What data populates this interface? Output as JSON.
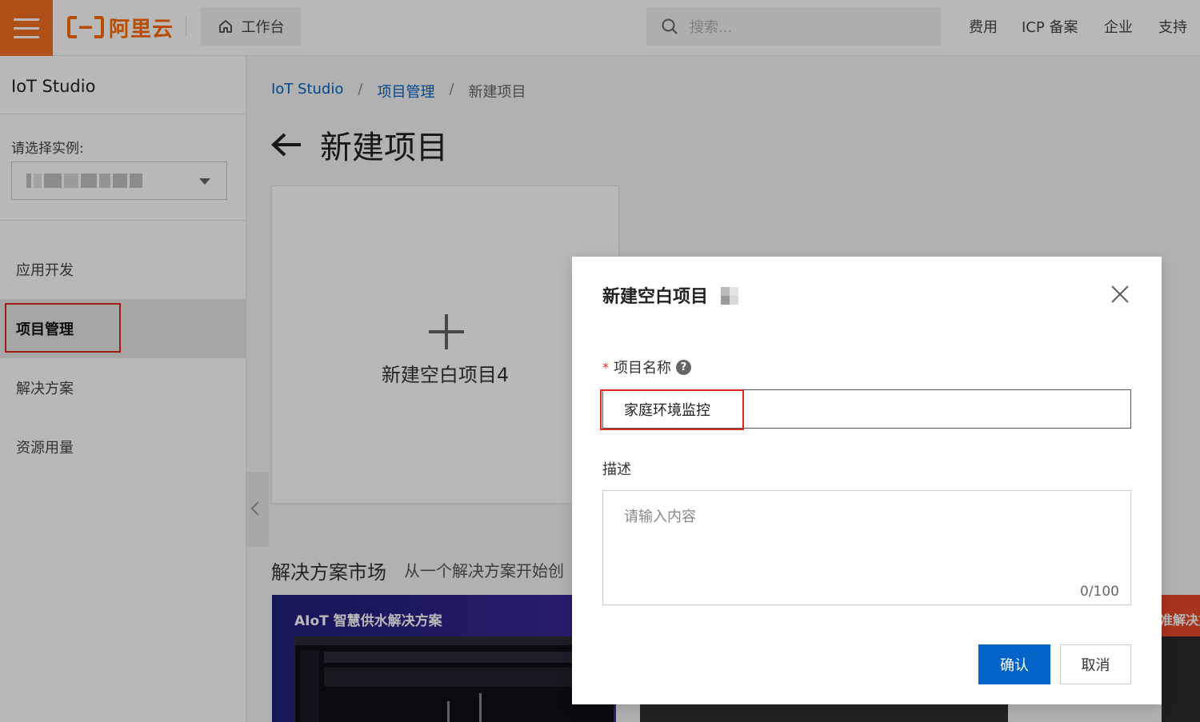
{
  "topbar": {
    "logo_text": "阿里云",
    "workbench_label": "工作台",
    "search_placeholder": "搜索...",
    "nav": [
      "费用",
      "ICP 备案",
      "企业",
      "支持"
    ]
  },
  "sidebar": {
    "title": "IoT Studio",
    "instance_label": "请选择实例:",
    "items": [
      {
        "label": "应用开发",
        "active": false
      },
      {
        "label": "项目管理",
        "active": true
      },
      {
        "label": "解决方案",
        "active": false
      },
      {
        "label": "资源用量",
        "active": false
      }
    ]
  },
  "breadcrumb": {
    "items": [
      "IoT Studio",
      "项目管理",
      "新建项目"
    ],
    "separator": "/"
  },
  "page": {
    "title": "新建项目",
    "new_card_label": "新建空白项目4",
    "solutions_title": "解决方案市场",
    "solutions_subtitle": "从一个解决方案开始创",
    "solution_card_1_title": "AIoT 智慧供水解决方案",
    "solution_card_3_title": "准解决方"
  },
  "dialog": {
    "title": "新建空白项目",
    "name_label": "项目名称",
    "name_value": "家庭环境监控",
    "desc_label": "描述",
    "desc_placeholder": "请输入内容",
    "desc_count": "0/100",
    "confirm_label": "确认",
    "cancel_label": "取消",
    "help_glyph": "?"
  },
  "colors": {
    "brand_orange": "#ff6a00",
    "hamburger_bg": "#f26f21",
    "primary_blue": "#0064c8",
    "highlight_red": "#e0281e"
  }
}
